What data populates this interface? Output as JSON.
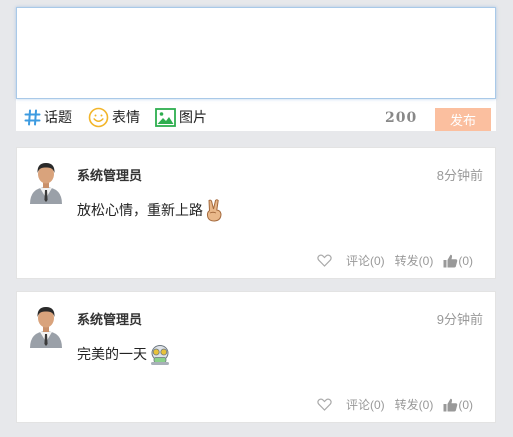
{
  "composer": {
    "placeholder": "",
    "tools": {
      "topic": "话题",
      "emoji": "表情",
      "image": "图片"
    },
    "char_count": "200",
    "publish_label": "发布"
  },
  "posts": [
    {
      "author": "系统管理员",
      "time": "8分钟前",
      "text": "放松心情，重新上路",
      "emoji": "victory-hand-icon",
      "comment_label": "评论(0)",
      "forward_label": "转发(0)",
      "like_label": "(0)"
    },
    {
      "author": "系统管理员",
      "time": "9分钟前",
      "text": "完美的一天",
      "emoji": "robot-face-icon",
      "comment_label": "评论(0)",
      "forward_label": "转发(0)",
      "like_label": "(0)"
    }
  ],
  "colors": {
    "background": "#e7e8eb",
    "publish_button": "#fbbf9f",
    "topic_icon": "#3d9be0",
    "emoji_icon": "#f2b52a",
    "image_icon": "#2eae4f"
  }
}
